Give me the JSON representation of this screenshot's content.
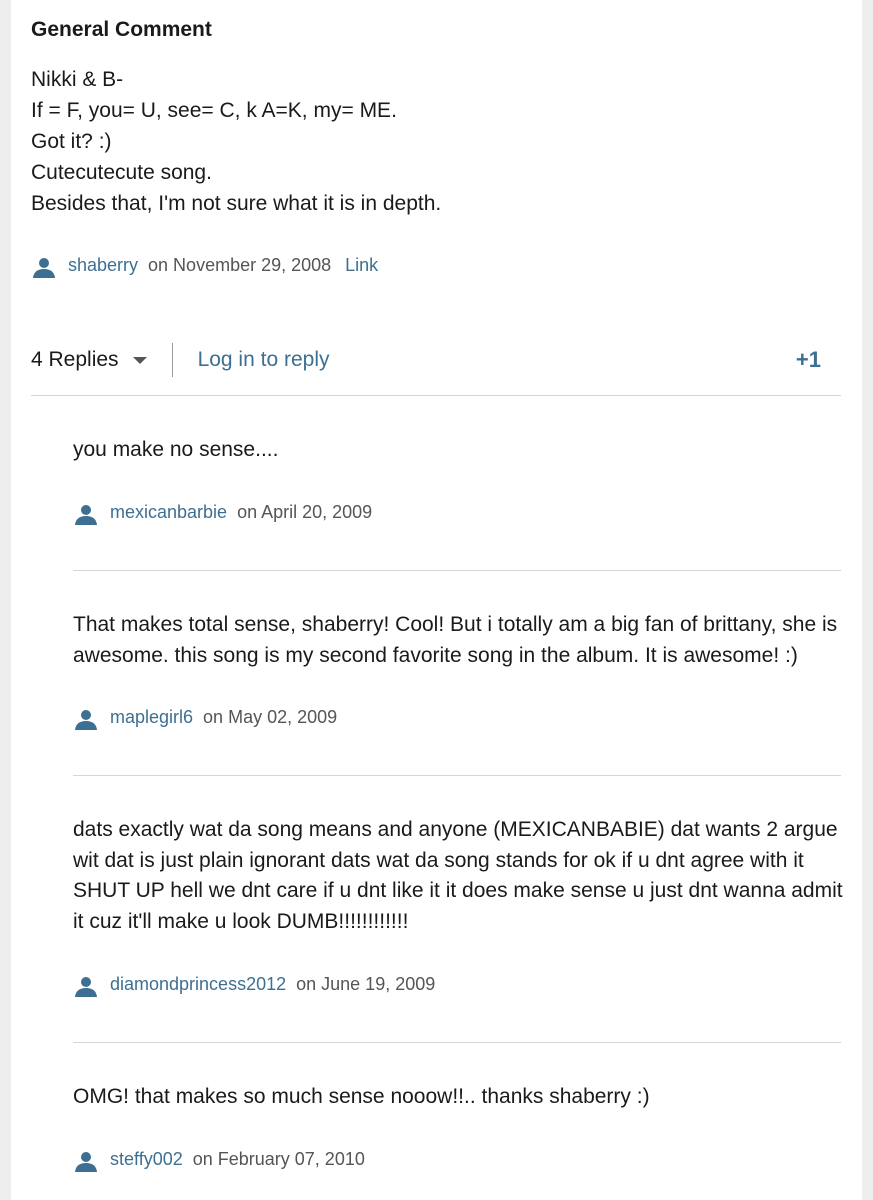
{
  "comment": {
    "header": "General Comment",
    "lines": [
      "Nikki & B-",
      "If = F, you= U, see= C, k A=K, my= ME.",
      "Got it? :)",
      "Cutecutecute song.",
      "Besides that, I'm not sure what it is in depth."
    ],
    "user": "shaberry",
    "date": "on November 29, 2008",
    "link_label": "Link"
  },
  "actions": {
    "replies_label": "4 Replies",
    "login_label": "Log in to reply",
    "vote_label": "+1"
  },
  "replies": [
    {
      "text": "you make no sense....",
      "user": "mexicanbarbie",
      "date": "on April 20, 2009"
    },
    {
      "text": "That makes total sense, shaberry! Cool! But i totally am a big fan of brittany, she is awesome. this song is my second favorite song in the album. It is awesome! :)",
      "user": "maplegirl6",
      "date": "on May 02, 2009"
    },
    {
      "text": "dats exactly wat da song means and anyone (MEXICANBABIE) dat wants 2 argue wit dat is just plain ignorant dats wat da song stands for ok if u dnt agree with it SHUT UP hell we dnt care if u dnt like it it does make sense u just dnt wanna admit it cuz it'll make u look DUMB!!!!!!!!!!!!",
      "user": "diamondprincess2012",
      "date": "on June 19, 2009"
    },
    {
      "text": "OMG! that makes so much sense nooow!!.. thanks shaberry :)",
      "user": "steffy002",
      "date": "on February 07, 2010"
    }
  ],
  "icons": {
    "user": "user-silhouette-icon",
    "caret": "caret-down-icon"
  },
  "colors": {
    "link": "#3d6f93",
    "text": "#1a1a1a",
    "meta": "#555555",
    "divider": "#d6d6d6"
  }
}
